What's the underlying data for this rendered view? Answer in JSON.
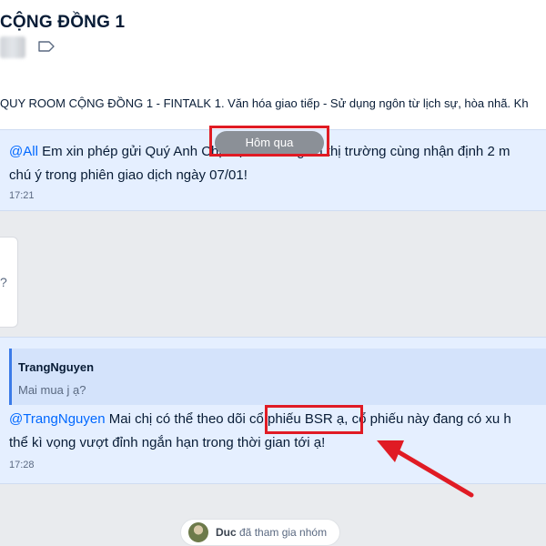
{
  "header": {
    "title": "CỘNG ĐỒNG 1"
  },
  "pinned": {
    "text": "QUY ROOM CỘNG ĐỒNG 1 - FINTALK   1. Văn hóa giao tiếp - Sử dụng ngôn từ lịch sự, hòa nhã. Kh"
  },
  "date_divider": "Hôm qua",
  "messages": [
    {
      "mention": "@All",
      "line1": " Em xin phép gửi Quý Anh Chị một số thông tin thị trường cùng nhận định 2 m",
      "line2": "chú ý trong phiên giao dịch ngày 07/01!",
      "time": "17:21"
    },
    {
      "quote_name": "TrangNguyen",
      "quote_text": "Mai mua j ạ?",
      "mention": "@TrangNguyen",
      "line1_a": " Mai chị có thể theo dõi ",
      "line1_b": "cổ phiếu BSR",
      "line1_c": " ạ, cổ phiếu này đang có xu h",
      "line2": "thể kì vọng vượt đỉnh ngắn hạn trong thời gian tới ạ!",
      "time": "17:28"
    }
  ],
  "side_card": {
    "text": "?"
  },
  "join_notice": {
    "name": "Duc",
    "text": " đã tham gia nhóm"
  },
  "colors": {
    "highlight_box": "#e01b24",
    "mention": "#0068ff",
    "message_bg": "#e5efff"
  }
}
